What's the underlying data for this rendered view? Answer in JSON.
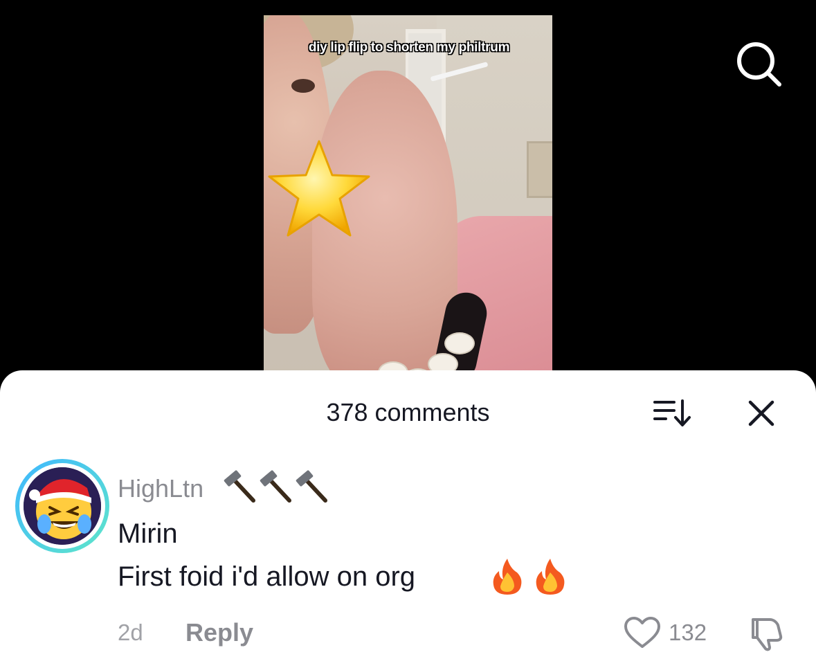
{
  "video": {
    "caption": "diy lip flip to shorten my philtrum",
    "sticker": "star-sticker"
  },
  "header": {
    "search_icon": "search-icon"
  },
  "comments_sheet": {
    "title": "378 comments",
    "sort_icon": "sort-icon",
    "close_icon": "close-icon",
    "comments": [
      {
        "username": "HighLtn",
        "username_emoji": [
          "hammer",
          "hammer",
          "hammer"
        ],
        "avatar": "santa-hat-crying-laughing-emoji-avatar",
        "lines": [
          "Mirin",
          "First foid i'd allow on org"
        ],
        "line_emoji": [
          "fire",
          "fire"
        ],
        "time": "2d",
        "reply_label": "Reply",
        "likes": "132",
        "like_icon": "heart-icon",
        "dislike_icon": "thumbs-down-icon"
      }
    ]
  },
  "colors": {
    "sheet_bg": "#ffffff",
    "text_primary": "#161823",
    "text_secondary": "#8a8b91",
    "avatar_ring_start": "#3fb7ff",
    "avatar_ring_end": "#5fe6c9"
  }
}
